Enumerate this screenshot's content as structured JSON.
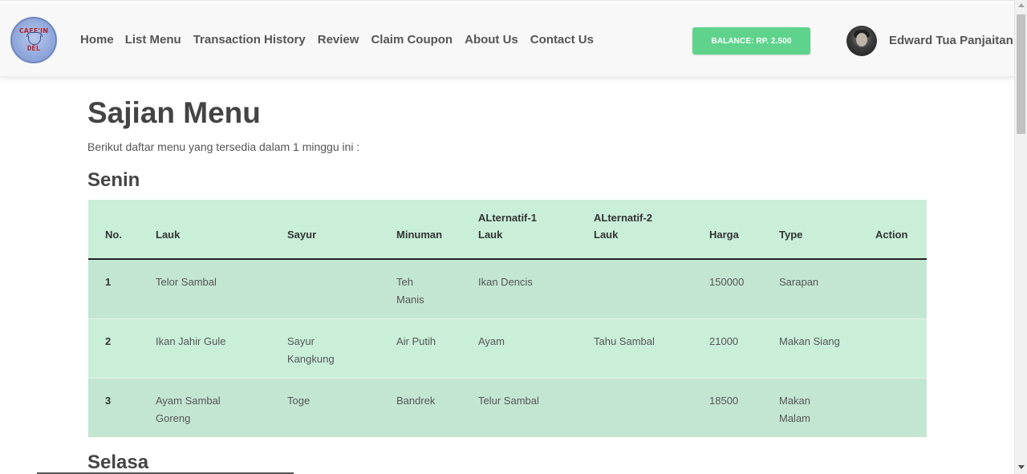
{
  "brand": {
    "logo_top_text": "CAFE'IN",
    "logo_bottom_text": "DEL"
  },
  "nav": {
    "links": [
      "Home",
      "List Menu",
      "Transaction History",
      "Review",
      "Claim Coupon",
      "About Us",
      "Contact Us"
    ]
  },
  "account": {
    "balance_label": "BALANCE: RP. 2.500",
    "username": "Edward Tua Panjaitan"
  },
  "page": {
    "title": "Sajian Menu",
    "subtitle": "Berikut daftar menu yang tersedia dalam 1 minggu ini :"
  },
  "days": [
    {
      "name": "Senin",
      "table": {
        "headers": {
          "no": "No.",
          "lauk": "Lauk",
          "sayur": "Sayur",
          "minuman": "Minuman",
          "alt1_line1": "ALternatif-1",
          "alt1_line2": "Lauk",
          "alt2_line1": "ALternatif-2",
          "alt2_line2": "Lauk",
          "harga": "Harga",
          "type": "Type",
          "action": "Action"
        },
        "rows": [
          {
            "no": "1",
            "lauk": "Telor Sambal",
            "sayur": "",
            "minuman_line1": "Teh",
            "minuman_line2": "Manis",
            "alt1": "Ikan Dencis",
            "alt2": "",
            "harga": "150000",
            "type_line1": "Sarapan",
            "type_line2": "",
            "action": ""
          },
          {
            "no": "2",
            "lauk_line1": "Ikan Jahir Gule",
            "sayur_line1": "Sayur",
            "sayur_line2": "Kangkung",
            "minuman": "Air Putih",
            "alt1": "Ayam",
            "alt2": "Tahu Sambal",
            "harga": "21000",
            "type": "Makan Siang",
            "action": ""
          },
          {
            "no": "3",
            "lauk_line1": "Ayam Sambal",
            "lauk_line2": "Goreng",
            "sayur": "Toge",
            "minuman": "Bandrek",
            "alt1": "Telur Sambal",
            "alt2": "",
            "harga": "18500",
            "type_line1": "Makan",
            "type_line2": "Malam",
            "action": ""
          }
        ]
      }
    },
    {
      "name": "Selasa"
    }
  ]
}
